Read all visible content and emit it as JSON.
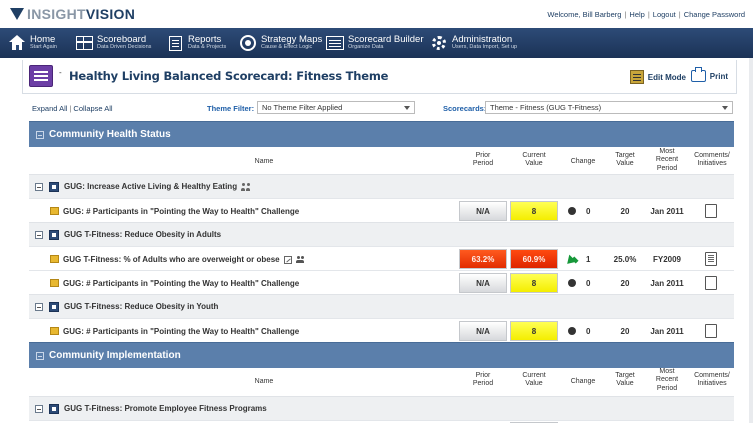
{
  "logo": {
    "insight": "INSIGHT",
    "vision": "VISION"
  },
  "userbar": {
    "welcome": "Welcome, Bill Barberg",
    "help": "Help",
    "logout": "Logout",
    "change_password": "Change Password",
    "sep": "|"
  },
  "nav": [
    {
      "label": "Home",
      "sub": "Start Again",
      "icon": "home-icon"
    },
    {
      "label": "Scoreboard",
      "sub": "Data Driven Decisions",
      "icon": "scoreboard-icon"
    },
    {
      "label": "Reports",
      "sub": "Data & Projects",
      "icon": "reports-icon"
    },
    {
      "label": "Strategy Maps",
      "sub": "Cause & Effect Logic",
      "icon": "strategy-map-icon"
    },
    {
      "label": "Scorecard Builder",
      "sub": "Organize Data",
      "icon": "builder-icon"
    },
    {
      "label": "Administration",
      "sub": "Users, Data Import, Set up",
      "icon": "gear-icon"
    }
  ],
  "title": {
    "dash": "-",
    "text": "Healthy Living Balanced Scorecard: Fitness Theme",
    "edit_mode": "Edit Mode",
    "print": "Print"
  },
  "filters": {
    "expand_all": "Expand All",
    "collapse_all": "Collapse All",
    "sep": "|",
    "theme_label": "Theme Filter:",
    "theme_value": "No Theme Filter Applied",
    "scorecards_label": "Scorecards:",
    "scorecards_value": "Theme - Fitness (GUG T-Fitness)"
  },
  "headers": {
    "name": "Name",
    "prior1": "Prior",
    "prior2": "Period",
    "curr1": "Current",
    "curr2": "Value",
    "change": "Change",
    "target1": "Target",
    "target2": "Value",
    "recent1": "Most",
    "recent2": "Recent",
    "recent3": "Period",
    "comments1": "Comments/",
    "comments2": "Initiatives"
  },
  "sections": [
    {
      "title": "Community Health Status"
    },
    {
      "title": "Community Implementation"
    }
  ],
  "groups": [
    {
      "name": "GUG: Increase Active Living & Healthy Eating"
    },
    {
      "name": "GUG T-Fitness: Reduce Obesity in Adults"
    },
    {
      "name": "GUG T-Fitness: Reduce Obesity in Youth"
    },
    {
      "name": "GUG T-Fitness: Promote Employee Fitness Programs"
    }
  ],
  "rows": [
    {
      "name": "GUG: # Participants in \"Pointing the Way to Health\" Challenge",
      "prior": "N/A",
      "current": "8",
      "change": "0",
      "target": "20",
      "recent": "Jan 2011"
    },
    {
      "name": "GUG T-Fitness: % of Adults who are overweight or obese",
      "prior": "63.2%",
      "current": "60.9%",
      "change": "1",
      "target": "25.0%",
      "recent": "FY2009"
    },
    {
      "name": "GUG: # Participants in \"Pointing the Way to Health\" Challenge",
      "prior": "N/A",
      "current": "8",
      "change": "0",
      "target": "20",
      "recent": "Jan 2011"
    },
    {
      "name": "GUG: # Participants in \"Pointing the Way to Health\" Challenge",
      "prior": "N/A",
      "current": "8",
      "change": "0",
      "target": "20",
      "recent": "Jan 2011"
    }
  ],
  "colors": {
    "nav": "#1f3a63",
    "section": "#5b7fab",
    "yellow": "#ffff2e",
    "red": "#f03c0c",
    "green": "#17983a"
  }
}
